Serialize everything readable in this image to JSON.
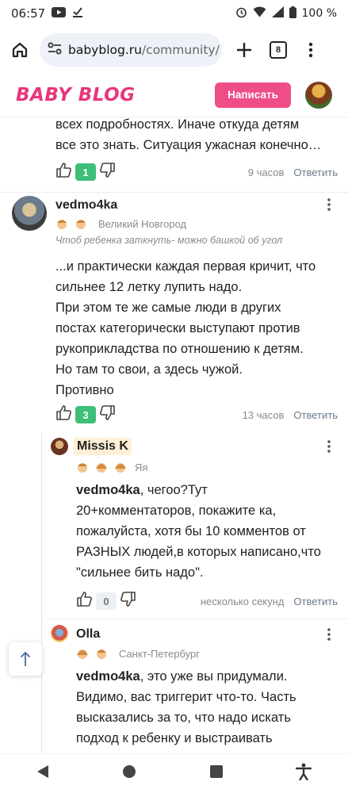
{
  "status_bar": {
    "time": "06:57",
    "battery": "100 %"
  },
  "browser": {
    "url_host": "babyblog.ru",
    "url_path": "/community/",
    "tab_count": "8"
  },
  "site": {
    "logo": "BABY BLOG",
    "write_button": "Написать"
  },
  "comments": [
    {
      "text_lines": [
        "всех подробностях. Иначе откуда детям",
        "все это знать. Ситуация ужасная конечно…"
      ],
      "likes": "1",
      "time": "9 часов",
      "reply": "Ответить"
    },
    {
      "author": "vedmo4ka",
      "location": "Великий Новгород",
      "status": "Чтоб ребенка заткнуть- можно башкой об угол",
      "text_lines": [
        "...и практически каждая первая кричит, что",
        "сильнее 12 летку лупить надо.",
        "При этом те же самые люди в других",
        "постах категорически выступают против",
        "рукоприкладства по отношению к детям.",
        "Но там то свои, а здесь чужой.",
        "Противно"
      ],
      "likes": "3",
      "time": "13 часов",
      "reply": "Ответить"
    },
    {
      "author": "Missis K",
      "self_label": "Яя",
      "mention": "vedmo4ka",
      "text_first": ", чегоо?Тут",
      "text_lines": [
        "20+комментаторов, покажите ка,",
        "пожалуйста, хотя бы 10 комментов от",
        "РАЗНЫХ людей,в которых написано,что",
        "\"сильнее бить надо\"."
      ],
      "likes": "0",
      "time": "несколько секунд",
      "reply": "Ответить"
    },
    {
      "author": "Olla",
      "location": "Санкт-Петербург",
      "mention": "vedmo4ka",
      "text_first": ", это уже вы придумали.",
      "text_lines": [
        "Видимо, вас триггерит что-то. Часть",
        "высказались за то, что надо искать",
        "подход к ребенку и выстраивать"
      ]
    }
  ],
  "colors": {
    "brand": "#e8367d",
    "button": "#ef4d87",
    "green": "#3ebf77"
  }
}
